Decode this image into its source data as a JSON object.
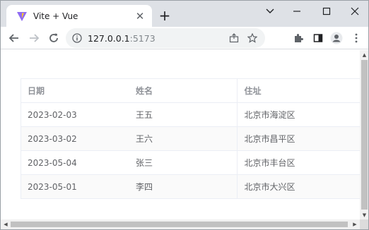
{
  "browser": {
    "tab_title": "Vite + Vue",
    "tab_close_glyph": "✕",
    "new_tab_glyph": "+",
    "url_host": "127.0.0.1",
    "url_port": ":5173"
  },
  "table": {
    "headers": [
      "日期",
      "姓名",
      "住址"
    ],
    "rows": [
      [
        "2023-02-03",
        "王五",
        "北京市海淀区"
      ],
      [
        "2023-03-02",
        "王六",
        "北京市昌平区"
      ],
      [
        "2023-05-04",
        "张三",
        "北京市丰台区"
      ],
      [
        "2023-05-01",
        "李四",
        "北京市大兴区"
      ]
    ]
  },
  "colors": {
    "tabstrip_bg": "#dee1e6",
    "header_text": "#909399",
    "cell_text": "#606266",
    "border": "#ebeef5",
    "stripe": "#fafafa"
  }
}
